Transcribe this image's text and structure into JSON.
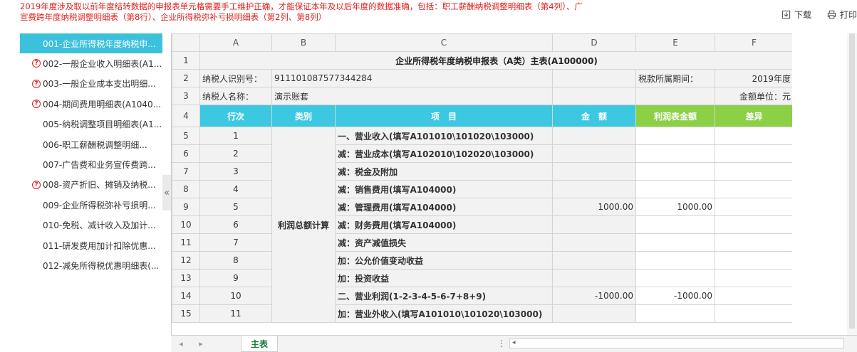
{
  "notice": "2019年度涉及取以前年度结转数据的申报表单元格需要手工维护正确，才能保证本年及以后年度的数据准确，包括：职工薪酬纳税调整明细表（第4列）、广宣费跨年度纳税调整明细表（第8行）、企业所得税弥补亏损明细表（第2列、第8列）",
  "toolbar": {
    "download": "下载",
    "print": "打印"
  },
  "sidebar": {
    "items": [
      {
        "label": "001-企业所得税年度纳税申...",
        "warn": false
      },
      {
        "label": "002-一般企业收入明细表(A1...",
        "warn": true
      },
      {
        "label": "003-一般企业成本支出明细...",
        "warn": true
      },
      {
        "label": "004-期间费用明细表(A1040...",
        "warn": true
      },
      {
        "label": "005-纳税调整项目明细表(A1...",
        "warn": false
      },
      {
        "label": "006-职工薪酬税调整明细...",
        "warn": false
      },
      {
        "label": "007-广告费和业务宣传费跨...",
        "warn": false
      },
      {
        "label": "008-资产折旧、摊销及纳税...",
        "warn": true
      },
      {
        "label": "009-企业所得税弥补亏损明...",
        "warn": false
      },
      {
        "label": "010-免税、减计收入及加计...",
        "warn": false
      },
      {
        "label": "011-研发费用加计扣除优惠...",
        "warn": false
      },
      {
        "label": "012-减免所得税优惠明细表(...",
        "warn": false
      }
    ],
    "collapse": "«",
    "warn_glyph": "?"
  },
  "sheet": {
    "columns": [
      "A",
      "B",
      "C",
      "D",
      "E",
      "F"
    ],
    "title": "企业所得税年度纳税申报表（A类）主表(A100000)",
    "taxpayer_id_label": "纳税人识别号：",
    "taxpayer_id": "911101087577344284",
    "period_label": "税款所属期间：",
    "period": "2019年度",
    "taxpayer_name_label": "纳税人名称：",
    "taxpayer_name": "演示账套",
    "unit": "金额单位：元",
    "headers": {
      "row_no": "行次",
      "category": "类别",
      "item": "项　目",
      "amount": "金　额",
      "profit_amount": "利润表金额",
      "diff": "差异"
    },
    "category": "利润总额计算",
    "rows": [
      {
        "n": "1",
        "item": "一、营业收入(填写A101010\\101020\\103000)",
        "amount": "",
        "profit": ""
      },
      {
        "n": "2",
        "item": "减：营业成本(填写A102010\\102020\\103000)",
        "amount": "",
        "profit": ""
      },
      {
        "n": "3",
        "item": "减：税金及附加",
        "amount": "",
        "profit": ""
      },
      {
        "n": "4",
        "item": "减：销售费用(填写A104000)",
        "amount": "",
        "profit": ""
      },
      {
        "n": "5",
        "item": "减：管理费用(填写A104000)",
        "amount": "1000.00",
        "profit": "1000.00"
      },
      {
        "n": "6",
        "item": "减：财务费用(填写A104000)",
        "amount": "",
        "profit": ""
      },
      {
        "n": "7",
        "item": "减：资产减值损失",
        "amount": "",
        "profit": ""
      },
      {
        "n": "8",
        "item": "加：公允价值变动收益",
        "amount": "",
        "profit": ""
      },
      {
        "n": "9",
        "item": "加：投资收益",
        "amount": "",
        "profit": ""
      },
      {
        "n": "10",
        "item": "二、营业利润(1-2-3-4-5-6-7+8+9)",
        "amount": "-1000.00",
        "profit": "-1000.00"
      },
      {
        "n": "11",
        "item": "加：营业外收入(填写A101010\\101020\\103000)",
        "amount": "",
        "profit": ""
      }
    ]
  },
  "bottombar": {
    "prev": "◂",
    "next": "▸",
    "tab": "主表",
    "dots": "⋮",
    "scroll_left": "◂"
  }
}
